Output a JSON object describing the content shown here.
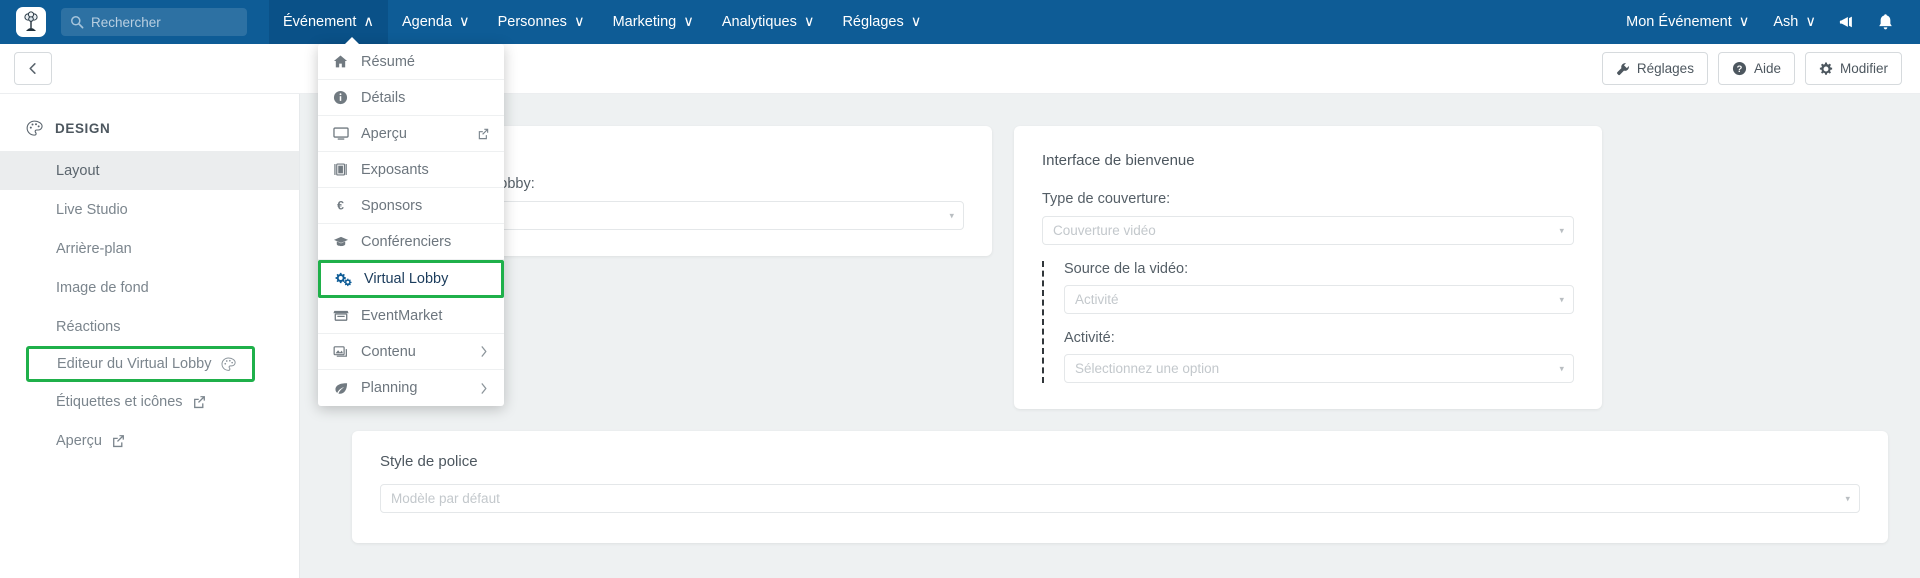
{
  "topnav": {
    "logo_icon": "app-logo-icon",
    "search": {
      "placeholder": "Rechercher",
      "value": "",
      "icon": "search-icon"
    },
    "menus": [
      {
        "label": "Événement",
        "caret": "∧",
        "state": "open"
      },
      {
        "label": "Agenda",
        "caret": "∨"
      },
      {
        "label": "Personnes",
        "caret": "∨"
      },
      {
        "label": "Marketing",
        "caret": "∨"
      },
      {
        "label": "Analytiques",
        "caret": "∨"
      },
      {
        "label": "Réglages",
        "caret": "∨"
      }
    ],
    "right": {
      "event_label": "Mon Événement",
      "event_caret": "∨",
      "user_label": "Ash",
      "user_caret": "∨",
      "announce_icon": "megaphone-icon",
      "bell_icon": "bell-icon"
    }
  },
  "subheader": {
    "back_icon": "chevron-left-icon",
    "actions": [
      {
        "label": "Réglages",
        "icon": "wrench-icon"
      },
      {
        "label": "Aide",
        "icon": "help-circle-icon"
      },
      {
        "label": "Modifier",
        "icon": "gear-icon"
      }
    ]
  },
  "sidebar": {
    "section": {
      "label": "DESIGN",
      "icon": "palette-icon"
    },
    "items": [
      {
        "label": "Layout",
        "state": "selected"
      },
      {
        "label": "Live Studio"
      },
      {
        "label": "Arrière-plan"
      },
      {
        "label": "Image de fond"
      },
      {
        "label": "Réactions"
      },
      {
        "label": "Editeur du Virtual Lobby",
        "icon": "palette-icon",
        "highlight": true
      },
      {
        "label": "Étiquettes et icônes",
        "icon": "external-link-icon"
      },
      {
        "label": "Aperçu",
        "icon": "external-link-icon"
      }
    ]
  },
  "dropdown": {
    "items": [
      {
        "label": "Résumé",
        "icon": "home-icon"
      },
      {
        "label": "Détails",
        "icon": "info-circle-icon"
      },
      {
        "label": "Aperçu",
        "icon": "monitor-icon",
        "trailing": "external-link-icon"
      },
      {
        "label": "Exposants",
        "icon": "book-icon"
      },
      {
        "label": "Sponsors",
        "icon": "euro-icon"
      },
      {
        "label": "Conférenciers",
        "icon": "graduation-cap-icon"
      },
      {
        "label": "Virtual Lobby",
        "icon": "cogs-icon",
        "highlight": true
      },
      {
        "label": "EventMarket",
        "icon": "store-icon"
      },
      {
        "label": "Contenu",
        "icon": "images-icon",
        "trailing": "chevron-right-icon"
      },
      {
        "label": "Planning",
        "icon": "leaf-icon",
        "trailing": "chevron-right-icon"
      }
    ]
  },
  "main": {
    "card_layout": {
      "field_label": "mise en page du Lobby:",
      "select_value": "",
      "caret": "▾"
    },
    "card_welcome": {
      "title": "Interface de bienvenue",
      "cover_label": "Type de couverture:",
      "cover_value": "Couverture vidéo",
      "source_label": "Source de la vidéo:",
      "source_value": "Activité",
      "activity_label": "Activité:",
      "activity_value": "Sélectionnez une option",
      "caret": "▾"
    },
    "card_font": {
      "title": "Style de police",
      "select_value": "Modèle par défaut",
      "caret": "▾"
    }
  },
  "colors": {
    "navbar": "#0e5c96",
    "highlight_green": "#1fb04a",
    "page_bg": "#eef1f2",
    "accent_blue": "#0e5c96"
  }
}
